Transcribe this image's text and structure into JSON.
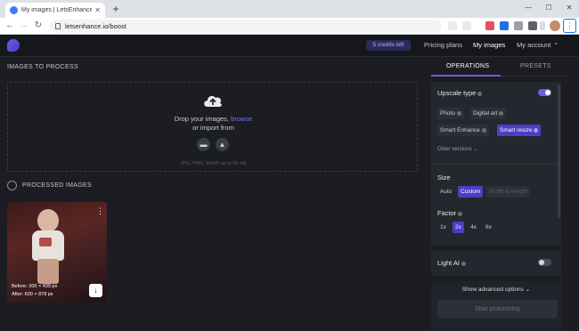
{
  "browser": {
    "tab_title": "My images | LetsEnhance.io - Im...",
    "url": "letsenhance.io/boost"
  },
  "header": {
    "credits": "5 credits left",
    "nav": [
      "Pricing plans",
      "My images",
      "My account"
    ],
    "account_caret": "⌄"
  },
  "main": {
    "to_process_title": "IMAGES TO PROCESS",
    "drop_text": "Drop your images,",
    "browse_link": "browse",
    "import_text": "or import from",
    "formats_hint": "JPG, PNG, WebP up to 50 mb",
    "processed_title": "PROCESSED IMAGES",
    "thumb": {
      "before": "Before: 300 × 439 px",
      "after": "After: 600 × 878 px"
    }
  },
  "panel": {
    "tabs": [
      "OPERATIONS",
      "PRESETS"
    ],
    "upscale_type_label": "Upscale type",
    "upscale_options": [
      "Photo",
      "Digital art",
      "Smart Enhance",
      "Smart resize"
    ],
    "older_versions": "Older versions",
    "size_label": "Size",
    "size_options": [
      "Auto",
      "Custom",
      "Width & Height"
    ],
    "factor_label": "Factor",
    "factor_options": [
      "1x",
      "2x",
      "4x",
      "6x"
    ],
    "light_ai_label": "Light AI",
    "advanced_options": "Show advanced options",
    "start_button": "Start processing"
  },
  "colors": {
    "accent": "#6c5ce7",
    "chip_selected": "#4a3fc4",
    "background": "#1b1d22"
  }
}
